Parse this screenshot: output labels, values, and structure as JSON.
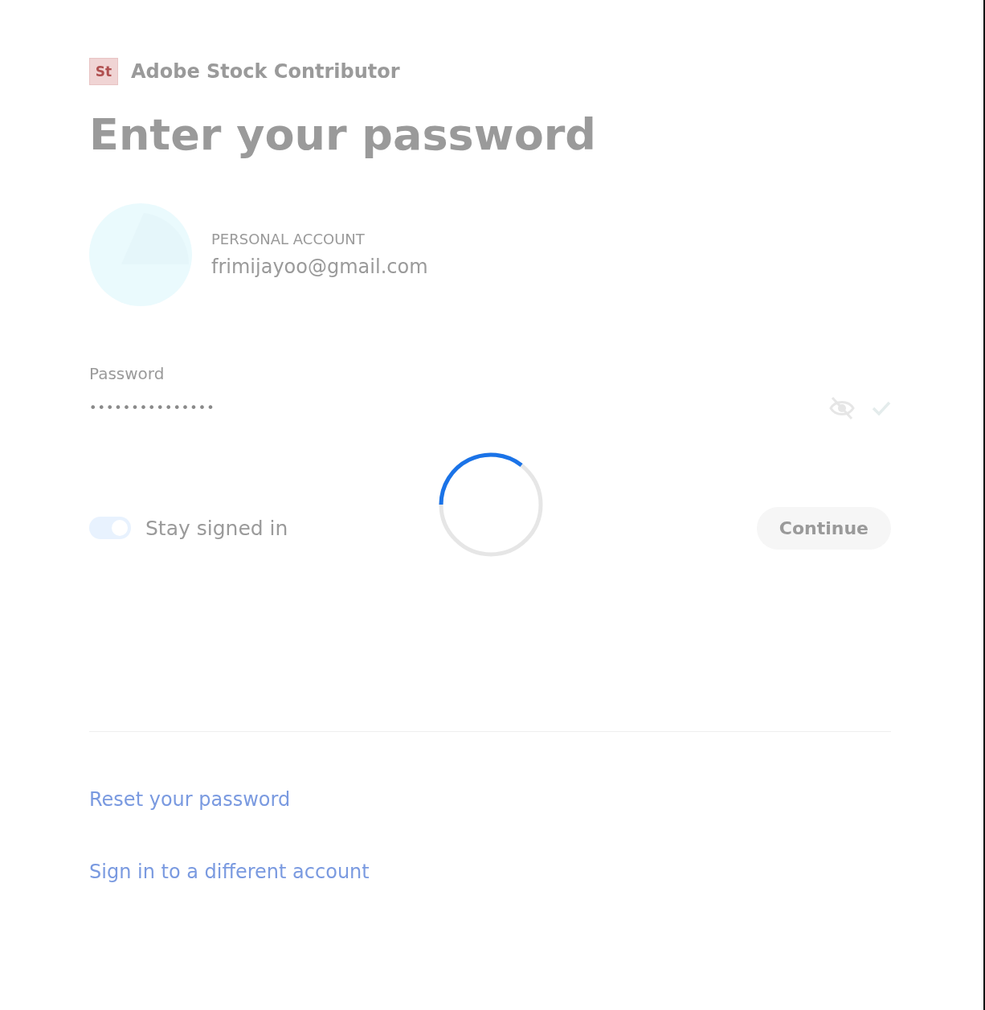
{
  "brand": {
    "logo": "St",
    "name": "Adobe Stock Contributor"
  },
  "heading": "Enter your password",
  "account": {
    "type": "PERSONAL ACCOUNT",
    "email": "frimijayoo@gmail.com"
  },
  "password": {
    "label": "Password",
    "value": "•••••••••••••••",
    "valid": true
  },
  "stay_signed_in": {
    "label": "Stay signed in",
    "on": true
  },
  "continue_button": "Continue",
  "links": [
    "Reset your password",
    "Sign in to a different account"
  ],
  "loading": true
}
